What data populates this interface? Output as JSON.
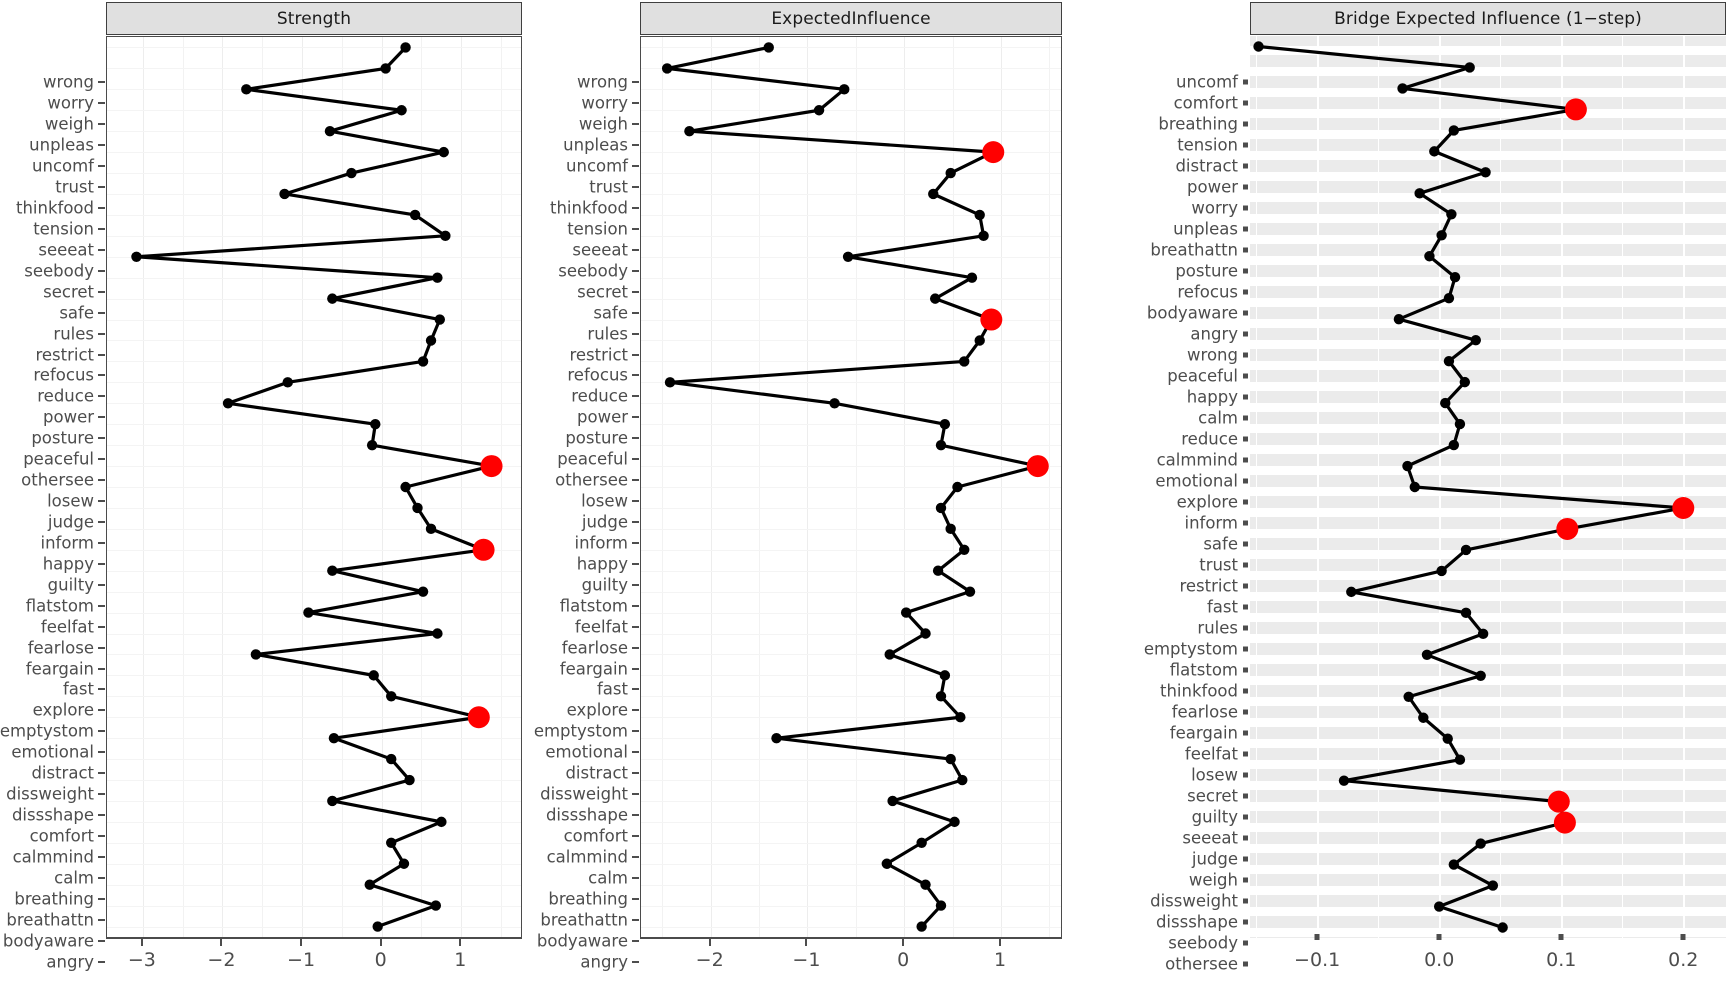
{
  "figure": {
    "type": "centrality-plot",
    "panel_count": 3
  },
  "panels": [
    {
      "id": "strength",
      "title": "Strength",
      "strip_style": "grey-bordered",
      "panel_background": "#ffffff",
      "x_ticks": [
        -3,
        -2,
        -1,
        0,
        1
      ],
      "x_tick_labels": [
        "−3",
        "−2",
        "−1",
        "0",
        "1"
      ],
      "x_range": [
        -3.45,
        1.75
      ],
      "tick_mark": "dash",
      "nodes": [
        {
          "label": "wrong",
          "value": 0.3
        },
        {
          "label": "worry",
          "value": 0.05
        },
        {
          "label": "weigh",
          "value": -1.7
        },
        {
          "label": "unpleas",
          "value": 0.25
        },
        {
          "label": "uncomf",
          "value": -0.65
        },
        {
          "label": "trust",
          "value": 0.78
        },
        {
          "label": "thinkfood",
          "value": -0.38
        },
        {
          "label": "tension",
          "value": -1.22
        },
        {
          "label": "seeeat",
          "value": 0.42
        },
        {
          "label": "seebody",
          "value": 0.8
        },
        {
          "label": "secret",
          "value": -3.08
        },
        {
          "label": "safe",
          "value": 0.7
        },
        {
          "label": "rules",
          "value": -0.62
        },
        {
          "label": "restrict",
          "value": 0.73
        },
        {
          "label": "refocus",
          "value": 0.62
        },
        {
          "label": "reduce",
          "value": 0.52
        },
        {
          "label": "power",
          "value": -1.18
        },
        {
          "label": "posture",
          "value": -1.93
        },
        {
          "label": "peaceful",
          "value": -0.08
        },
        {
          "label": "othersee",
          "value": -0.12
        },
        {
          "label": "losew",
          "value": 1.38,
          "highlight": true
        },
        {
          "label": "judge",
          "value": 0.3
        },
        {
          "label": "inform",
          "value": 0.45
        },
        {
          "label": "happy",
          "value": 0.62
        },
        {
          "label": "guilty",
          "value": 1.28,
          "highlight": true
        },
        {
          "label": "flatstom",
          "value": -0.62
        },
        {
          "label": "feelfat",
          "value": 0.52
        },
        {
          "label": "fearlose",
          "value": -0.92
        },
        {
          "label": "feargain",
          "value": 0.7
        },
        {
          "label": "fast",
          "value": -1.58
        },
        {
          "label": "explore",
          "value": -0.1
        },
        {
          "label": "emptystom",
          "value": 0.12
        },
        {
          "label": "emotional",
          "value": 1.22,
          "highlight": true
        },
        {
          "label": "distract",
          "value": -0.6
        },
        {
          "label": "dissweight",
          "value": 0.12
        },
        {
          "label": "dissshape",
          "value": 0.35
        },
        {
          "label": "comfort",
          "value": -0.62
        },
        {
          "label": "calmmind",
          "value": 0.75
        },
        {
          "label": "calm",
          "value": 0.12
        },
        {
          "label": "breathing",
          "value": 0.28
        },
        {
          "label": "breathattn",
          "value": -0.15
        },
        {
          "label": "bodyaware",
          "value": 0.68
        },
        {
          "label": "angry",
          "value": -0.05
        }
      ]
    },
    {
      "id": "expected-influence",
      "title": "ExpectedInfluence",
      "strip_style": "grey-bordered",
      "panel_background": "#ffffff",
      "x_ticks": [
        -2,
        -1,
        0,
        1
      ],
      "x_tick_labels": [
        "−2",
        "−1",
        "0",
        "1"
      ],
      "x_range": [
        -2.72,
        1.62
      ],
      "tick_mark": "dash",
      "nodes": [
        {
          "label": "wrong",
          "value": -1.4
        },
        {
          "label": "worry",
          "value": -2.45
        },
        {
          "label": "weigh",
          "value": -0.62
        },
        {
          "label": "unpleas",
          "value": -0.88
        },
        {
          "label": "uncomf",
          "value": -2.22
        },
        {
          "label": "trust",
          "value": 0.92,
          "highlight": true
        },
        {
          "label": "thinkfood",
          "value": 0.48
        },
        {
          "label": "tension",
          "value": 0.3
        },
        {
          "label": "seeeat",
          "value": 0.78
        },
        {
          "label": "seebody",
          "value": 0.82
        },
        {
          "label": "secret",
          "value": -0.58
        },
        {
          "label": "safe",
          "value": 0.7
        },
        {
          "label": "rules",
          "value": 0.32
        },
        {
          "label": "restrict",
          "value": 0.9,
          "highlight": true
        },
        {
          "label": "refocus",
          "value": 0.78
        },
        {
          "label": "reduce",
          "value": 0.62
        },
        {
          "label": "power",
          "value": -2.42
        },
        {
          "label": "posture",
          "value": -0.72
        },
        {
          "label": "peaceful",
          "value": 0.42
        },
        {
          "label": "othersee",
          "value": 0.38
        },
        {
          "label": "losew",
          "value": 1.38,
          "highlight": true
        },
        {
          "label": "judge",
          "value": 0.55
        },
        {
          "label": "inform",
          "value": 0.38
        },
        {
          "label": "happy",
          "value": 0.48
        },
        {
          "label": "guilty",
          "value": 0.62
        },
        {
          "label": "flatstom",
          "value": 0.35
        },
        {
          "label": "feelfat",
          "value": 0.68
        },
        {
          "label": "fearlose",
          "value": 0.02
        },
        {
          "label": "feargain",
          "value": 0.22
        },
        {
          "label": "fast",
          "value": -0.15
        },
        {
          "label": "explore",
          "value": 0.42
        },
        {
          "label": "emptystom",
          "value": 0.38
        },
        {
          "label": "emotional",
          "value": 0.58
        },
        {
          "label": "distract",
          "value": -1.32
        },
        {
          "label": "dissweight",
          "value": 0.48
        },
        {
          "label": "dissshape",
          "value": 0.6
        },
        {
          "label": "comfort",
          "value": -0.12
        },
        {
          "label": "calmmind",
          "value": 0.52
        },
        {
          "label": "calm",
          "value": 0.18
        },
        {
          "label": "breathing",
          "value": -0.18
        },
        {
          "label": "breathattn",
          "value": 0.22
        },
        {
          "label": "bodyaware",
          "value": 0.38
        },
        {
          "label": "angry",
          "value": 0.18
        }
      ]
    },
    {
      "id": "bridge-expected-influence",
      "title": "Bridge Expected Influence (1−step)",
      "strip_style": "grey-bordered",
      "panel_background": "#ebebeb",
      "x_ticks": [
        -0.1,
        0.0,
        0.1,
        0.2
      ],
      "x_tick_labels": [
        "−0.1",
        "0.0",
        "0.1",
        "0.2"
      ],
      "x_range": [
        -0.155,
        0.235
      ],
      "tick_mark": "square",
      "nodes": [
        {
          "label": "uncomf",
          "value": -0.148
        },
        {
          "label": "comfort",
          "value": 0.025
        },
        {
          "label": "breathing",
          "value": -0.03
        },
        {
          "label": "tension",
          "value": 0.112,
          "highlight": true
        },
        {
          "label": "distract",
          "value": 0.012
        },
        {
          "label": "power",
          "value": -0.004
        },
        {
          "label": "worry",
          "value": 0.038
        },
        {
          "label": "unpleas",
          "value": -0.016
        },
        {
          "label": "breathattn",
          "value": 0.01
        },
        {
          "label": "posture",
          "value": 0.002
        },
        {
          "label": "refocus",
          "value": -0.008
        },
        {
          "label": "bodyaware",
          "value": 0.013
        },
        {
          "label": "angry",
          "value": 0.008
        },
        {
          "label": "wrong",
          "value": -0.033
        },
        {
          "label": "peaceful",
          "value": 0.03
        },
        {
          "label": "happy",
          "value": 0.008
        },
        {
          "label": "calm",
          "value": 0.021
        },
        {
          "label": "reduce",
          "value": 0.005
        },
        {
          "label": "calmmind",
          "value": 0.017
        },
        {
          "label": "emotional",
          "value": 0.012
        },
        {
          "label": "explore",
          "value": -0.026
        },
        {
          "label": "inform",
          "value": -0.02
        },
        {
          "label": "safe",
          "value": 0.2,
          "highlight": true
        },
        {
          "label": "trust",
          "value": 0.105,
          "highlight": true
        },
        {
          "label": "restrict",
          "value": 0.022
        },
        {
          "label": "fast",
          "value": 0.002
        },
        {
          "label": "rules",
          "value": -0.072
        },
        {
          "label": "emptystom",
          "value": 0.022
        },
        {
          "label": "flatstom",
          "value": 0.036
        },
        {
          "label": "thinkfood",
          "value": -0.01
        },
        {
          "label": "fearlose",
          "value": 0.034
        },
        {
          "label": "feargain",
          "value": -0.025
        },
        {
          "label": "feelfat",
          "value": -0.013
        },
        {
          "label": "losew",
          "value": 0.007
        },
        {
          "label": "secret",
          "value": 0.017
        },
        {
          "label": "guilty",
          "value": -0.078
        },
        {
          "label": "seeeat",
          "value": 0.098,
          "highlight": true
        },
        {
          "label": "judge",
          "value": 0.103,
          "highlight": true
        },
        {
          "label": "weigh",
          "value": 0.034
        },
        {
          "label": "dissweight",
          "value": 0.012
        },
        {
          "label": "dissshape",
          "value": 0.044
        },
        {
          "label": "seebody",
          "value": 0.0
        },
        {
          "label": "othersee",
          "value": 0.052
        }
      ]
    }
  ],
  "colors": {
    "point": "#000000",
    "highlight": "#ff0000",
    "line": "#000000",
    "strip_background": "#e0e0e0",
    "grey_panel": "#ebebeb",
    "axis_text": "#4d4d4d"
  }
}
